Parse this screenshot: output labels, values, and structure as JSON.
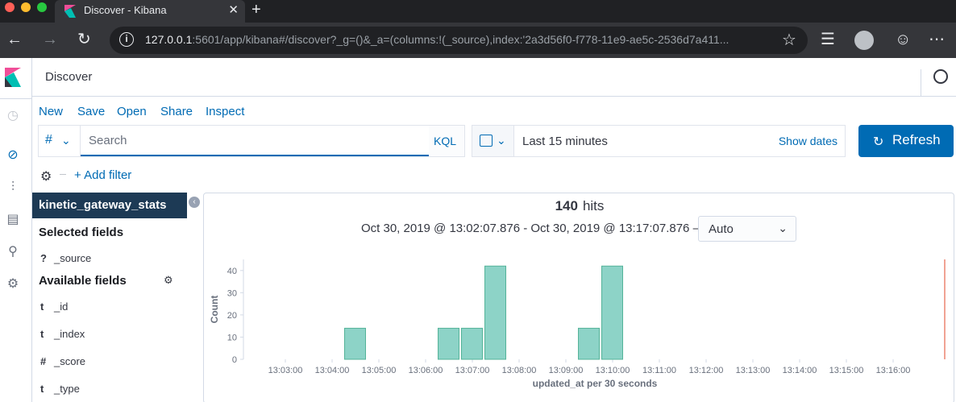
{
  "browser": {
    "tab_title": "Discover - Kibana",
    "url_host": "127.0.0.1",
    "url_rest": ":5601/app/kibana#/discover?_g=()&_a=(columns:!(_source),index:'2a3d56f0-f778-11e9-ae5c-2536d7a411..."
  },
  "header": {
    "breadcrumb": "Discover"
  },
  "menu": {
    "new": "New",
    "save": "Save",
    "open": "Open",
    "share": "Share",
    "inspect": "Inspect"
  },
  "query": {
    "lang_symbol": "#",
    "placeholder": "Search",
    "kql": "KQL"
  },
  "date": {
    "range": "Last 15 minutes",
    "show_dates": "Show dates"
  },
  "refresh": {
    "label": "Refresh"
  },
  "filter": {
    "add": "+ Add filter"
  },
  "sidebar": {
    "index_pattern": "kinetic_gateway_stats",
    "selected_title": "Selected fields",
    "selected_fields": [
      {
        "type": "?",
        "name": "_source"
      }
    ],
    "available_title": "Available fields",
    "available_fields": [
      {
        "type": "t",
        "name": "_id"
      },
      {
        "type": "t",
        "name": "_index"
      },
      {
        "type": "#",
        "name": "_score"
      },
      {
        "type": "t",
        "name": "_type"
      }
    ]
  },
  "results": {
    "hits": "140",
    "hits_label": "hits",
    "time_range": "Oct 30, 2019 @ 13:02:07.876 - Oct 30, 2019 @ 13:17:07.876 —",
    "interval": "Auto"
  },
  "chart_data": {
    "type": "bar",
    "xlabel": "updated_at per 30 seconds",
    "ylabel": "Count",
    "ylim": [
      0,
      45
    ],
    "yticks": [
      0,
      10,
      20,
      30,
      40
    ],
    "xticks": [
      "13:03:00",
      "13:04:00",
      "13:05:00",
      "13:06:00",
      "13:07:00",
      "13:08:00",
      "13:09:00",
      "13:10:00",
      "13:11:00",
      "13:12:00",
      "13:13:00",
      "13:14:00",
      "13:15:00",
      "13:16:00"
    ],
    "bars": [
      {
        "x": "13:04:30",
        "value": 14
      },
      {
        "x": "13:06:30",
        "value": 14
      },
      {
        "x": "13:07:00",
        "value": 14
      },
      {
        "x": "13:07:30",
        "value": 42
      },
      {
        "x": "13:09:30",
        "value": 14
      },
      {
        "x": "13:10:00",
        "value": 42
      }
    ],
    "bar_color": "#8dd3c7",
    "bar_stroke": "#54b399",
    "now_line_color": "#e7664c"
  }
}
